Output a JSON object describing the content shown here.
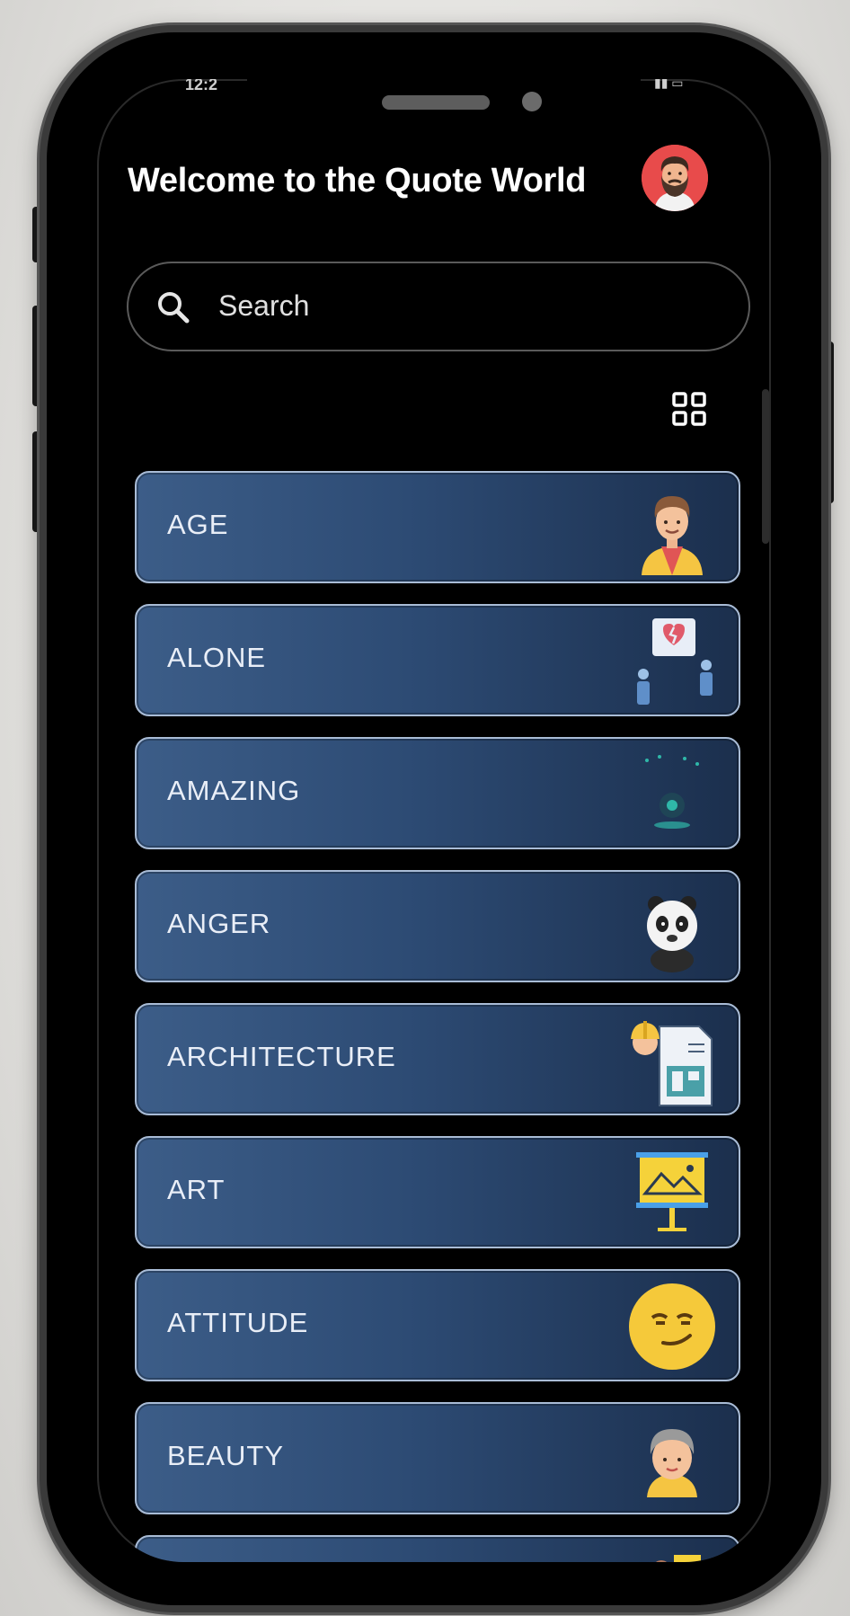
{
  "header": {
    "title": "Welcome to the Quote World",
    "status_time": "12:2",
    "avatar_icon": "bearded-man-avatar"
  },
  "search": {
    "placeholder": "Search",
    "icon": "search-icon"
  },
  "view_toggle": {
    "icon": "grid-view-icon"
  },
  "categories": [
    {
      "label": "AGE",
      "icon": "young-man-icon"
    },
    {
      "label": "ALONE",
      "icon": "broken-heart-people-icon"
    },
    {
      "label": "AMAZING",
      "icon": "sparkle-icon"
    },
    {
      "label": "ANGER",
      "icon": "panda-icon"
    },
    {
      "label": "ARCHITECTURE",
      "icon": "architect-blueprint-icon"
    },
    {
      "label": "ART",
      "icon": "art-easel-icon"
    },
    {
      "label": "ATTITUDE",
      "icon": "smirk-emoji-icon"
    },
    {
      "label": "BEAUTY",
      "icon": "woman-face-icon"
    },
    {
      "label": "",
      "icon": "partial-card-icon"
    }
  ],
  "colors": {
    "card_top": "#3c5d88",
    "card_end": "#1b2f4d",
    "card_border": "#a9bcd6",
    "avatar_bg": "#e84b4b"
  }
}
